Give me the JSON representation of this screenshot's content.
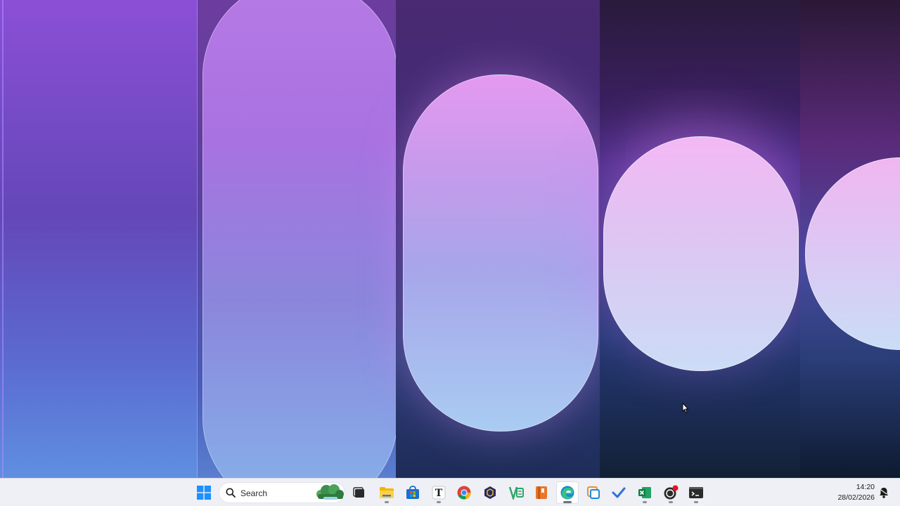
{
  "taskbar": {
    "search": {
      "label": "Search",
      "icon": "search-icon"
    },
    "apps": [
      {
        "name": "start",
        "icon": "windows-logo-icon"
      },
      {
        "name": "weather",
        "icon": "weather-widget-icon"
      },
      {
        "name": "task-view",
        "icon": "task-view-icon"
      },
      {
        "name": "file-explorer",
        "icon": "folder-icon"
      },
      {
        "name": "microsoft-store",
        "icon": "store-icon"
      },
      {
        "name": "typora",
        "icon": "text-editor-icon",
        "glyph": "T"
      },
      {
        "name": "chrome",
        "icon": "chrome-icon"
      },
      {
        "name": "dev-tool",
        "icon": "hexagon-icon"
      },
      {
        "name": "visual-studio",
        "icon": "vs-icon"
      },
      {
        "name": "books",
        "icon": "bookmark-app-icon"
      },
      {
        "name": "edge",
        "icon": "edge-icon"
      },
      {
        "name": "snipping-tool",
        "icon": "snip-icon"
      },
      {
        "name": "todo",
        "icon": "checkmark-icon"
      },
      {
        "name": "excel",
        "icon": "excel-icon"
      },
      {
        "name": "obs",
        "icon": "record-icon"
      },
      {
        "name": "terminal",
        "icon": "terminal-icon"
      }
    ],
    "clock": {
      "time": "14:20",
      "date": "28/02/2026"
    },
    "notification_icon": "notification-bell-icon"
  },
  "colors": {
    "taskbar_bg": "#eef0f5",
    "wallpaper_top": "#8b4fd6",
    "wallpaper_bottom": "#6a9be8",
    "accent_blue": "#0078d4"
  }
}
